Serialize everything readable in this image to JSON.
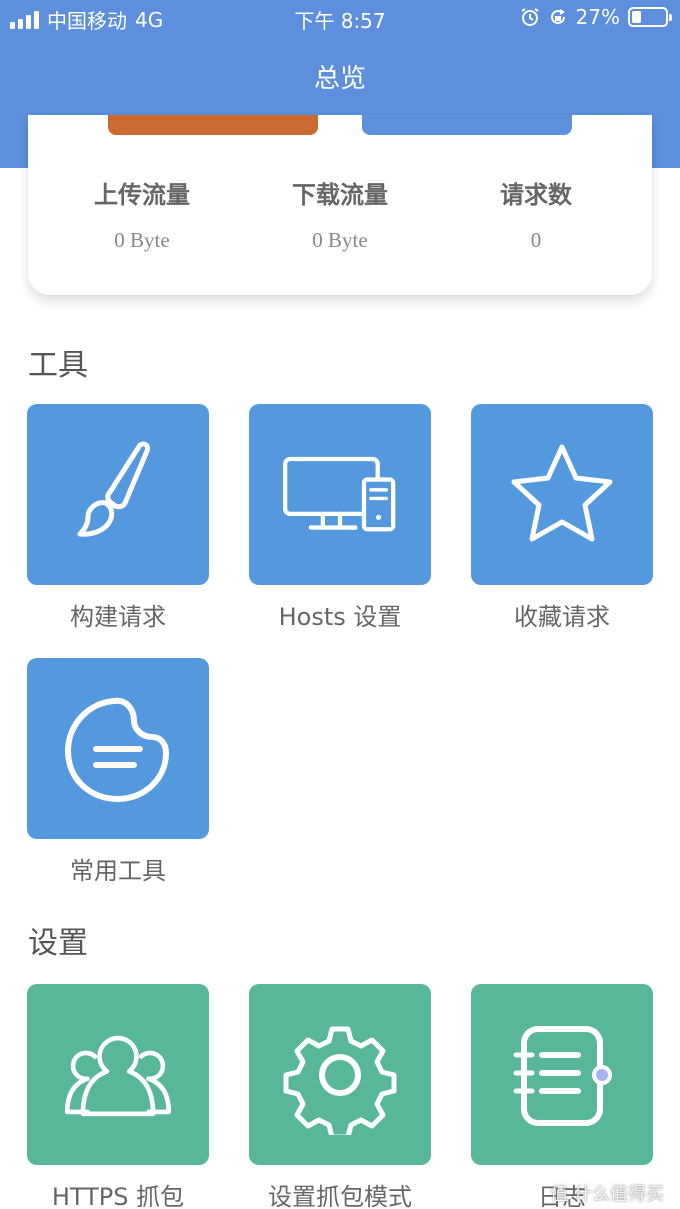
{
  "status_bar": {
    "carrier": "中国移动",
    "network": "4G",
    "time": "下午 8:57",
    "battery_percent": "27%",
    "battery_level": 0.27
  },
  "nav": {
    "title": "总览"
  },
  "stats": [
    {
      "label": "上传流量",
      "value": "0 Byte"
    },
    {
      "label": "下载流量",
      "value": "0 Byte"
    },
    {
      "label": "请求数",
      "value": "0"
    }
  ],
  "sections": {
    "tools": {
      "title": "工具",
      "items": [
        {
          "label": "构建请求",
          "icon": "paintbrush-icon"
        },
        {
          "label": "Hosts 设置",
          "icon": "desktop-computer-icon"
        },
        {
          "label": "收藏请求",
          "icon": "star-icon"
        },
        {
          "label": "常用工具",
          "icon": "palette-icon"
        }
      ]
    },
    "settings": {
      "title": "设置",
      "items": [
        {
          "label": "HTTPS 抓包",
          "icon": "users-icon"
        },
        {
          "label": "设置抓包模式",
          "icon": "gear-icon"
        },
        {
          "label": "日志",
          "icon": "notebook-icon"
        }
      ]
    }
  },
  "watermark": "值 什么值得买",
  "colors": {
    "header": "#5d8fdc",
    "tab_orange": "#cc6a32",
    "tile_blue": "#5499de",
    "tile_green": "#58b699"
  }
}
